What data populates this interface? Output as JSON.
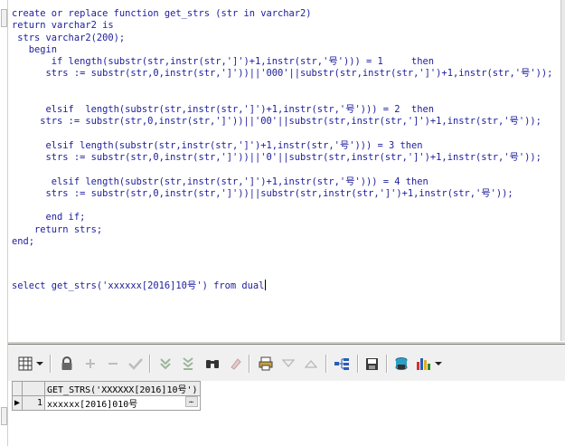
{
  "editor": {
    "lines": [
      "create or replace function get_strs (str in varchar2)",
      "return varchar2 is",
      " strs varchar2(200);",
      "   begin",
      "       if length(substr(str,instr(str,']')+1,instr(str,'号'))) = 1     then",
      "      strs := substr(str,0,instr(str,']'))||'000'||substr(str,instr(str,']')+1,instr(str,'号'));",
      "",
      "",
      "      elsif  length(substr(str,instr(str,']')+1,instr(str,'号'))) = 2  then",
      "     strs := substr(str,0,instr(str,']'))||'00'||substr(str,instr(str,']')+1,instr(str,'号'));",
      "",
      "      elsif length(substr(str,instr(str,']')+1,instr(str,'号'))) = 3 then",
      "      strs := substr(str,0,instr(str,']'))||'0'||substr(str,instr(str,']')+1,instr(str,'号'));",
      "",
      "       elsif length(substr(str,instr(str,']')+1,instr(str,'号'))) = 4 then",
      "      strs := substr(str,0,instr(str,']'))||substr(str,instr(str,']')+1,instr(str,'号'));",
      "",
      "      end if;",
      "    return strs;",
      "end;",
      "",
      "",
      "",
      "",
      "select get_strs('xxxxxx[2016]10号') from dual"
    ]
  },
  "toolbar": {
    "buttons": [
      {
        "name": "grid-view-icon"
      },
      {
        "name": "lock-icon"
      },
      {
        "name": "add-record-icon"
      },
      {
        "name": "delete-record-icon"
      },
      {
        "name": "post-changes-icon"
      },
      {
        "name": "next-page-icon"
      },
      {
        "name": "last-page-icon"
      },
      {
        "name": "find-icon"
      },
      {
        "name": "clear-icon"
      },
      {
        "name": "print-icon"
      },
      {
        "name": "sort-down-icon"
      },
      {
        "name": "sort-up-icon"
      },
      {
        "name": "explain-plan-icon"
      },
      {
        "name": "save-icon"
      },
      {
        "name": "export-icon"
      },
      {
        "name": "chart-icon"
      }
    ]
  },
  "results": {
    "columns": [
      "GET_STRS('XXXXXX[2016]10号')"
    ],
    "rows": [
      {
        "num": "1",
        "indicator": "▶",
        "values": [
          "xxxxxx[2016]010号"
        ]
      }
    ],
    "cell_button": "…"
  },
  "colors": {
    "keyword": "#1c1c9c",
    "string": "#1c1c9c"
  }
}
